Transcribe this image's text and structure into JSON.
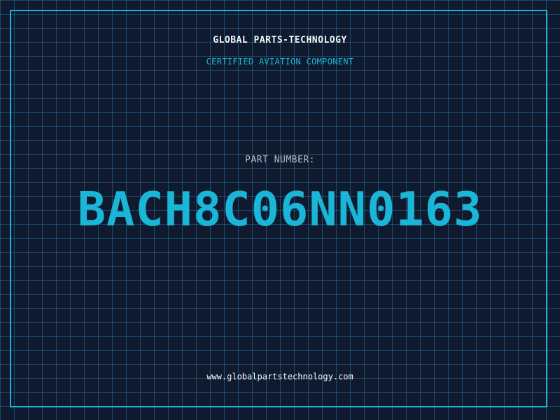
{
  "header": {
    "brand": "GLOBAL PARTS-TECHNOLOGY",
    "tagline": "CERTIFIED AVIATION COMPONENT"
  },
  "part": {
    "label": "PART NUMBER:",
    "number": "BACH8C06NN0163"
  },
  "footer": {
    "website": "www.globalpartstechnology.com"
  },
  "colors": {
    "background": "#101a2e",
    "grid": "#266e96",
    "accent": "#1ab6d8",
    "text": "#f2f6fa",
    "muted": "#b5bfcc"
  }
}
